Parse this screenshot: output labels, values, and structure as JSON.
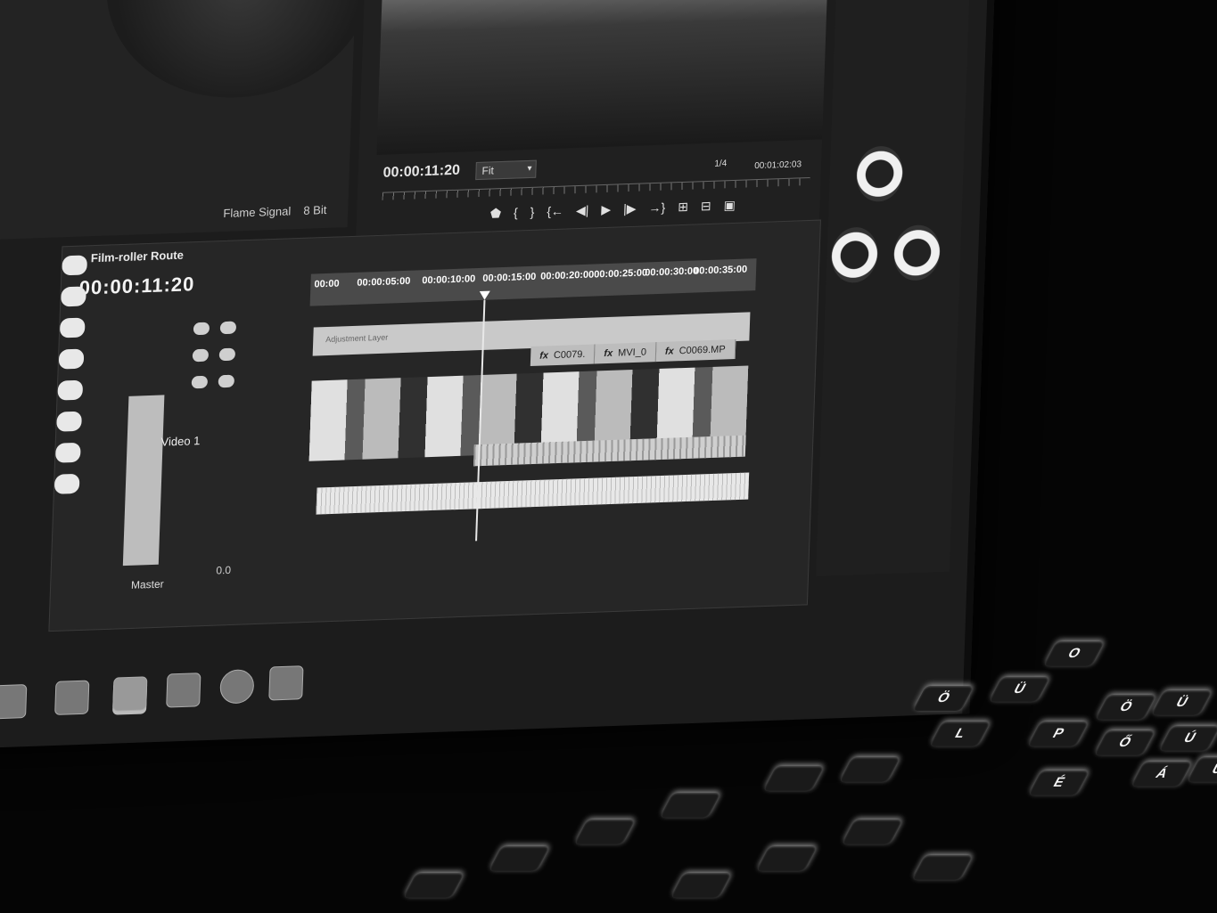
{
  "program_monitor": {
    "timecode": "00:00:11:20",
    "fit_select": "Fit",
    "resolution": "1/4",
    "duration": "00:01:02:03",
    "transport_glyphs": [
      "⬟",
      "{",
      "}",
      "{←",
      "◀|",
      "▶",
      "|▶",
      "→}",
      "⊞",
      "⊟",
      "▣"
    ]
  },
  "source_panel": {
    "flame_label": "Flame Signal",
    "flame_value": "8 Bit"
  },
  "timeline": {
    "sequence_title": "Film-roller Route",
    "timecode": "00:00:11:20",
    "ruler_ticks": [
      "00:00",
      "00:00:05:00",
      "00:00:10:00",
      "00:00:15:00",
      "00:00:20:00",
      "00:00:25:00",
      "00:00:30:00",
      "00:00:35:00"
    ],
    "v2_clip_name": "Adjustment Layer",
    "clips": [
      {
        "fx": "fx",
        "name": "C0079."
      },
      {
        "fx": "fx",
        "name": "MVI_0"
      },
      {
        "fx": "fx",
        "name": "C0069.MP"
      }
    ],
    "video1_label": "Video 1",
    "master_label": "Master",
    "master_value": "0.0"
  },
  "keyboard": {
    "keys": [
      "Ö",
      "Ü",
      "O",
      "Ö",
      "Ü",
      "P",
      "Ő",
      "Ú",
      "Á",
      "Ű",
      "L",
      "É"
    ]
  },
  "colors": {
    "background": "#050505",
    "panel": "#262626",
    "key_glow": "#f5f5f5"
  }
}
